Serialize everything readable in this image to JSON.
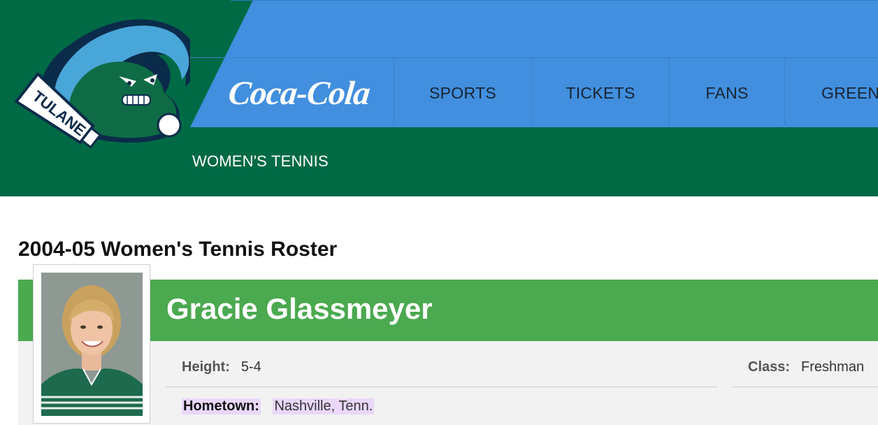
{
  "header": {
    "sponsor": "Coca-Cola",
    "nav": [
      "SPORTS",
      "TICKETS",
      "FANS",
      "GREEN"
    ],
    "section_title": "WOMEN'S TENNIS",
    "logo_text": "TULANE",
    "colors": {
      "green": "#006a45",
      "blue": "#418fde",
      "accent_green": "#4ba94f"
    }
  },
  "roster": {
    "title": "2004-05 Women's Tennis Roster",
    "player": {
      "name": "Gracie Glassmeyer",
      "height_label": "Height:",
      "height": "5-4",
      "class_label": "Class:",
      "class": "Freshman",
      "hometown_label": "Hometown",
      "hometown": "Nashville, Tenn."
    }
  }
}
